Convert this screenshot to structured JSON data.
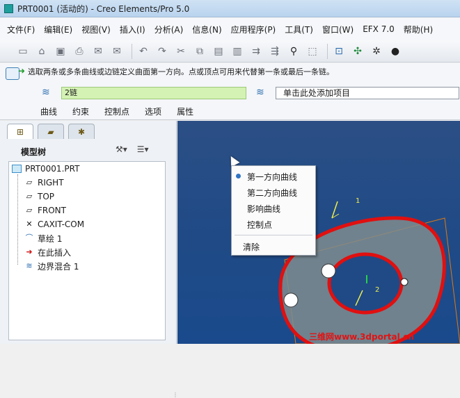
{
  "window": {
    "title": "PRT0001 (活动的) - Creo Elements/Pro 5.0"
  },
  "menu": [
    "文件(F)",
    "编辑(E)",
    "视图(V)",
    "插入(I)",
    "分析(A)",
    "信息(N)",
    "应用程序(P)",
    "工具(T)",
    "窗口(W)",
    "EFX 7.0",
    "帮助(H)"
  ],
  "toolbar": {
    "icons": [
      "new-icon",
      "open-icon",
      "save-icon",
      "print-icon",
      "email-icon",
      "email-attach-icon",
      "undo-icon",
      "redo-icon",
      "cut-icon",
      "copy-icon",
      "paste-icon",
      "paste-special-icon",
      "regen-icon",
      "regen-manager-icon",
      "find-icon",
      "select-box-icon",
      "view-icon",
      "datum-icon",
      "spin-icon",
      "shade-icon"
    ]
  },
  "dashboard": {
    "hint": "选取两条或多条曲线或边链定义曲面第一方向。点或顶点可用来代替第一条或最后一条链。",
    "first_dir_value": "2链",
    "second_dir_value": "单击此处添加项目",
    "tabs": [
      "曲线",
      "约束",
      "控制点",
      "选项",
      "属性"
    ]
  },
  "panel": {
    "title": "模型树",
    "tree": [
      {
        "label": "PRT0001.PRT",
        "icon": "part-icon"
      },
      {
        "label": "RIGHT",
        "icon": "datum-plane-icon"
      },
      {
        "label": "TOP",
        "icon": "datum-plane-icon"
      },
      {
        "label": "FRONT",
        "icon": "datum-plane-icon"
      },
      {
        "label": "CAXIT-COM",
        "icon": "coordinate-system-icon"
      },
      {
        "label": "草绘 1",
        "icon": "sketch-icon"
      },
      {
        "label": "在此插入",
        "icon": "insert-here-arrow-icon"
      },
      {
        "label": "边界混合 1",
        "icon": "boundary-blend-icon"
      }
    ]
  },
  "context_menu": {
    "items": [
      "第一方向曲线",
      "第二方向曲线",
      "影响曲线",
      "控制点"
    ],
    "selected": "第一方向曲线",
    "clear": "清除"
  },
  "canvas": {
    "labels": [
      "1",
      "2"
    ],
    "watermark": "三维网www.3dportal.cn",
    "colors": {
      "background": "#1f4a86",
      "surface": "#7f8c8e",
      "curve": "#e01010",
      "frame": "#e07a10",
      "label": "#f2f04a"
    }
  }
}
